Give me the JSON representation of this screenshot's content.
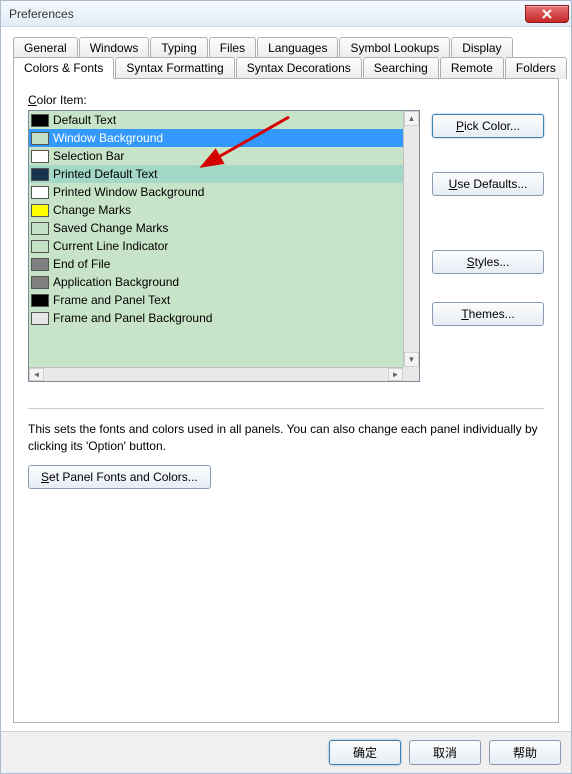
{
  "window": {
    "title": "Preferences"
  },
  "tabs_row1": [
    {
      "label": "General"
    },
    {
      "label": "Windows"
    },
    {
      "label": "Typing"
    },
    {
      "label": "Files"
    },
    {
      "label": "Languages"
    },
    {
      "label": "Symbol Lookups"
    },
    {
      "label": "Display"
    }
  ],
  "tabs_row2": [
    {
      "label": "Colors & Fonts",
      "active": true
    },
    {
      "label": "Syntax Formatting"
    },
    {
      "label": "Syntax Decorations"
    },
    {
      "label": "Searching"
    },
    {
      "label": "Remote"
    },
    {
      "label": "Folders"
    }
  ],
  "panel": {
    "label_prefix": "C",
    "label_rest": "olor Item:",
    "items": [
      {
        "name": "Default Text",
        "color": "#000000"
      },
      {
        "name": "Window Background",
        "color": "#c6e2c6",
        "selected": true
      },
      {
        "name": "Selection Bar",
        "color": "#ffffff"
      },
      {
        "name": "Printed Default Text",
        "color": "#18344e",
        "alt": true
      },
      {
        "name": "Printed Window Background",
        "color": "#ffffff"
      },
      {
        "name": "Change Marks",
        "color": "#ffff00"
      },
      {
        "name": "Saved Change Marks",
        "color": "#c6e2c6"
      },
      {
        "name": "Current Line Indicator",
        "color": "#c6e2c6"
      },
      {
        "name": "End of File",
        "color": "#808080"
      },
      {
        "name": "Application Background",
        "color": "#808080"
      },
      {
        "name": "Frame and Panel Text",
        "color": "#000000"
      },
      {
        "name": "Frame and Panel Background",
        "color": "#e6e6e6"
      }
    ],
    "desc": "This sets the fonts and colors used in all panels. You can also change each panel individually by clicking its 'Option' button.",
    "set_panel_btn_pre": "S",
    "set_panel_btn_rest": "et Panel Fonts and Colors..."
  },
  "right_buttons": {
    "pick_pre": "P",
    "pick_rest": "ick Color...",
    "defaults_pre": "U",
    "defaults_rest": "se Defaults...",
    "styles_pre": "S",
    "styles_rest": "tyles...",
    "themes_pre": "T",
    "themes_rest": "hemes..."
  },
  "bottom": {
    "ok": "确定",
    "cancel": "取消",
    "help": "帮助"
  }
}
